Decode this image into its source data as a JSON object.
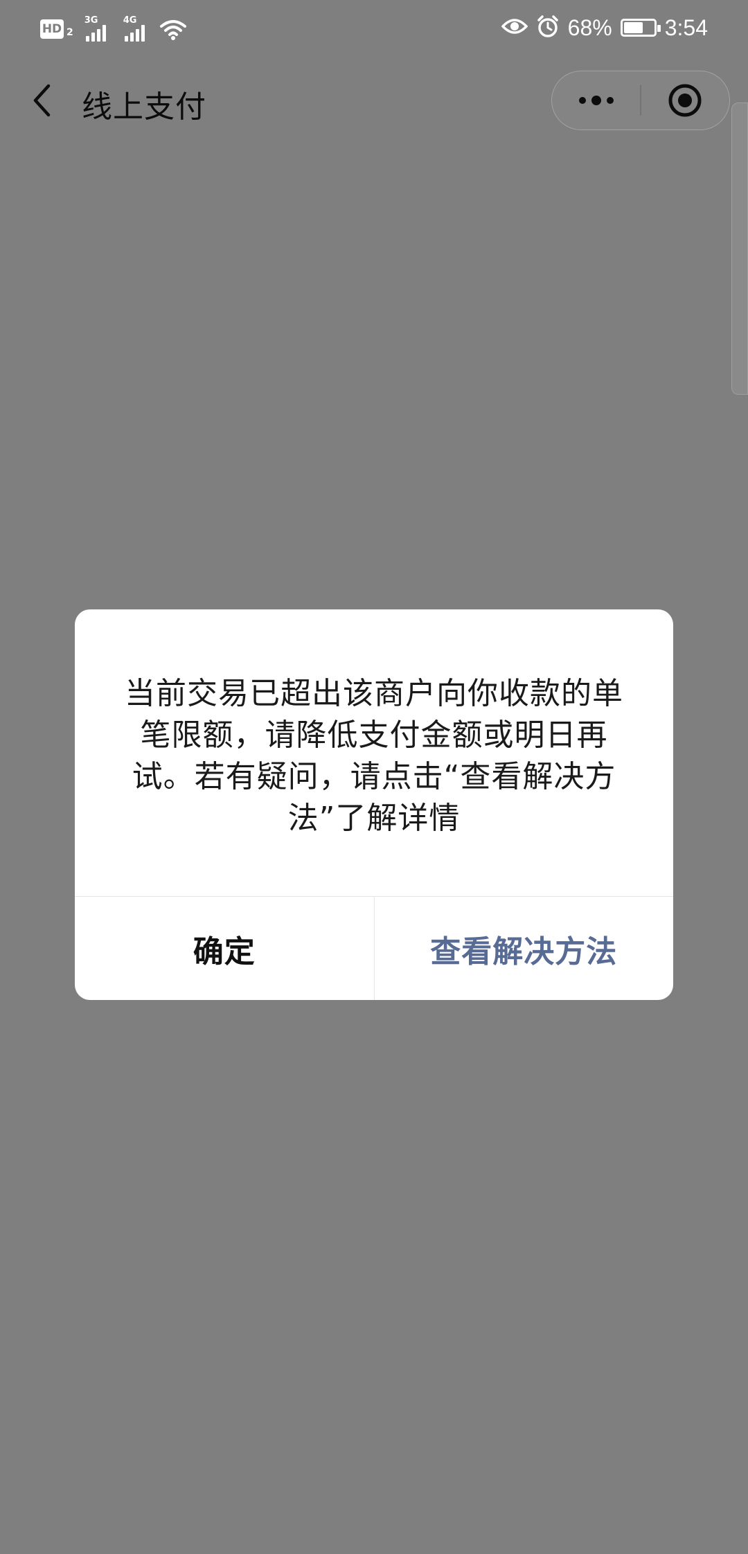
{
  "status_bar": {
    "hd_label": "HD",
    "hd_sub": "2",
    "net1_label": "3G",
    "net2_label": "4G",
    "battery_percent": "68%",
    "battery_level": 0.68,
    "time": "3:54",
    "icons": [
      "eye-icon",
      "alarm-icon",
      "battery-icon",
      "wifi-icon",
      "signal-icon"
    ]
  },
  "header": {
    "title": "线上支付",
    "icons": [
      "back-arrow-icon",
      "more-dots-icon",
      "close-target-icon"
    ]
  },
  "dialog": {
    "message": "当前交易已超出该商户向你收款的单笔限额，请降低支付金额或明日再试。若有疑问，请点击“查看解决方法”了解详情",
    "confirm_label": "确定",
    "solution_label": "查看解决方法"
  },
  "colors": {
    "overlay_background": "#7f7f7f",
    "dialog_background": "#ffffff",
    "link_blue": "#576b95"
  }
}
